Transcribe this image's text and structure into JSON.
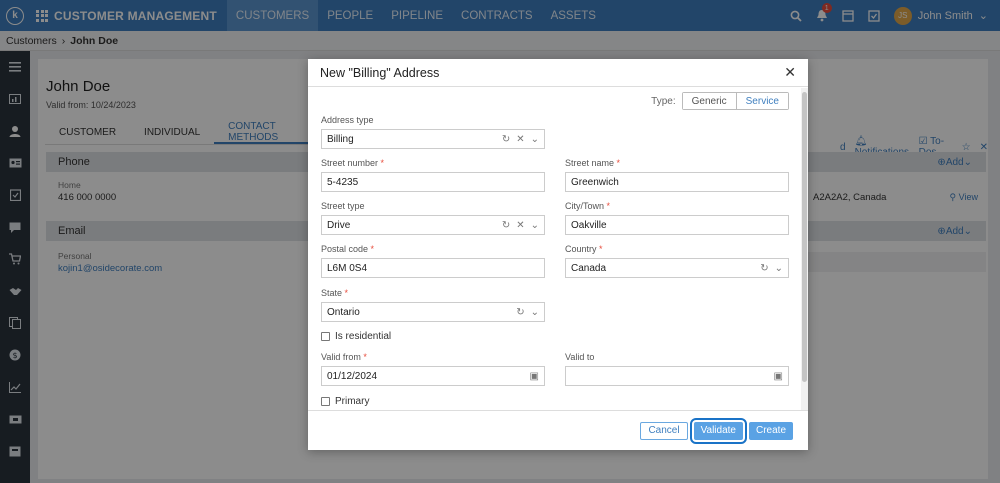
{
  "topbar": {
    "logo_letter": "k",
    "app_title": "CUSTOMER MANAGEMENT",
    "nav": [
      "CUSTOMERS",
      "PEOPLE",
      "PIPELINE",
      "CONTRACTS",
      "ASSETS"
    ],
    "notification_count": "1",
    "user_initials": "JS",
    "user_name": "John Smith"
  },
  "breadcrumb": {
    "root": "Customers",
    "current": "John Doe"
  },
  "page": {
    "title": "John Doe",
    "valid_from": "Valid from: 10/24/2023",
    "tabs": [
      "CUSTOMER",
      "INDIVIDUAL",
      "CONTACT METHODS"
    ],
    "header_links": {
      "partial": "d",
      "notifications": "Notifications",
      "todos": "To-Dos"
    },
    "phone": {
      "title": "Phone",
      "label": "Home",
      "value": "416 000 0000"
    },
    "email": {
      "title": "Email",
      "label": "Personal",
      "value": "kojin1@osidecorate.com"
    },
    "right": {
      "add": "Add",
      "address_partial": "A2A2A2, Canada",
      "view": "View"
    }
  },
  "modal": {
    "title": "New \"Billing\" Address",
    "type_label": "Type:",
    "type_options": [
      "Generic",
      "Service"
    ],
    "fields": {
      "address_type": {
        "label": "Address type",
        "value": "Billing"
      },
      "street_number": {
        "label": "Street number",
        "value": "5-4235"
      },
      "street_name": {
        "label": "Street name",
        "value": "Greenwich"
      },
      "street_type": {
        "label": "Street type",
        "value": "Drive"
      },
      "city": {
        "label": "City/Town",
        "value": "Oakville"
      },
      "postal_code": {
        "label": "Postal code",
        "value": "L6M 0S4"
      },
      "country": {
        "label": "Country",
        "value": "Canada"
      },
      "state": {
        "label": "State",
        "value": "Ontario"
      },
      "is_residential": "Is residential",
      "valid_from": {
        "label": "Valid from",
        "value": "01/12/2024"
      },
      "valid_to": {
        "label": "Valid to",
        "value": ""
      },
      "primary": "Primary"
    },
    "buttons": {
      "cancel": "Cancel",
      "validate": "Validate",
      "create": "Create"
    }
  }
}
